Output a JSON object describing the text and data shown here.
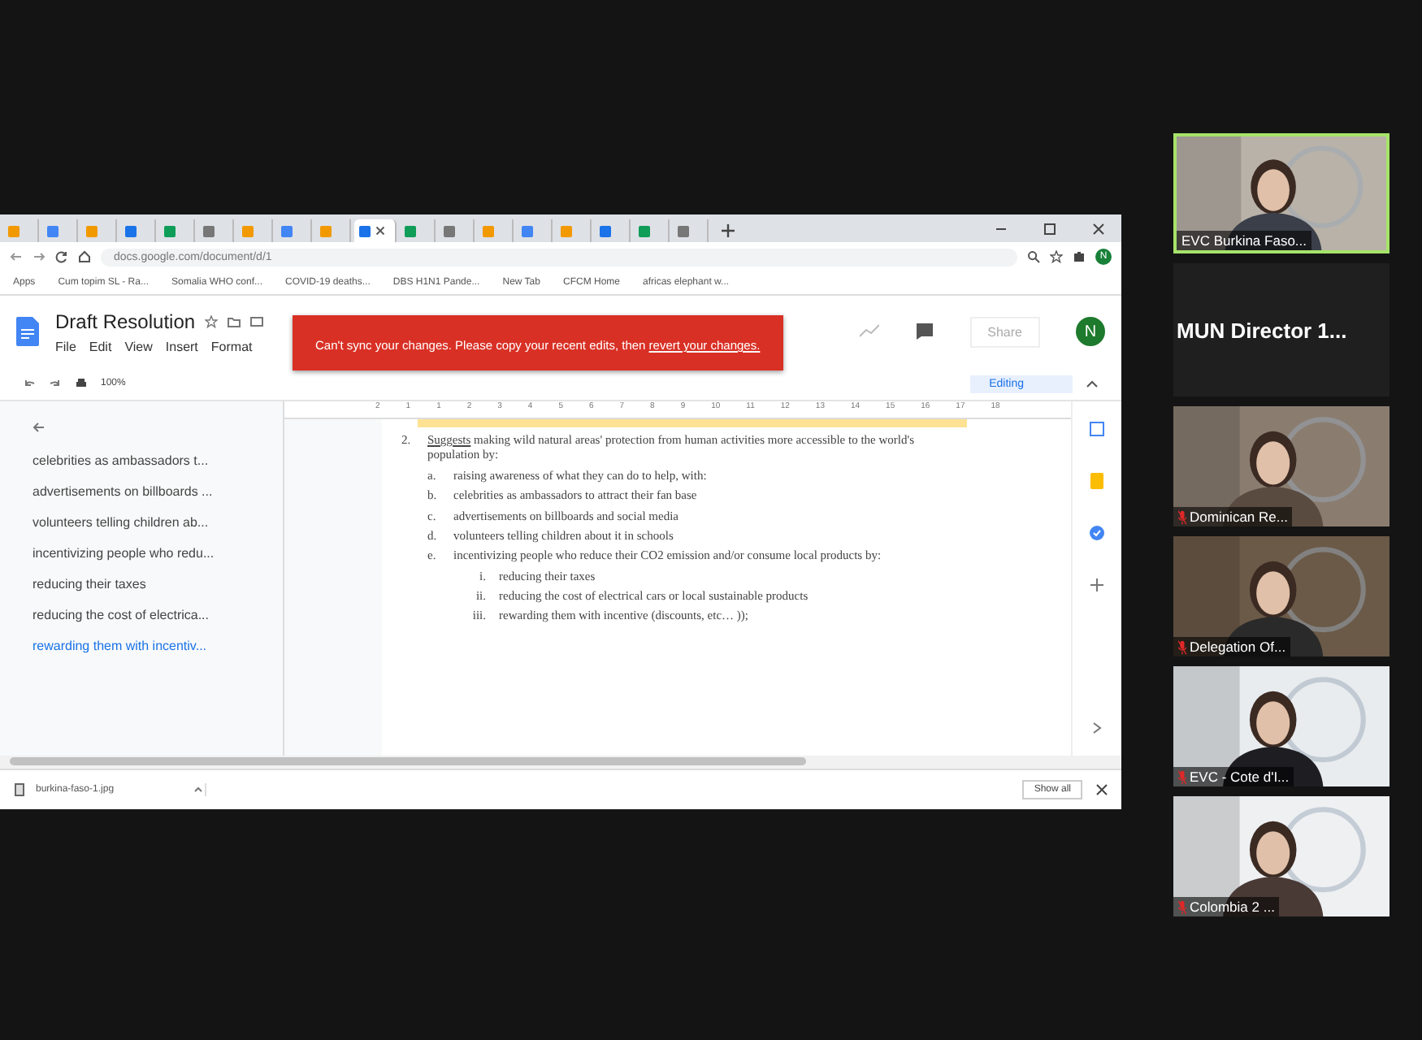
{
  "browser": {
    "tabs": [
      {
        "selected": false
      },
      {
        "selected": false
      },
      {
        "selected": false
      },
      {
        "selected": false
      },
      {
        "selected": false
      },
      {
        "selected": false
      },
      {
        "selected": false
      },
      {
        "selected": false
      },
      {
        "selected": false
      },
      {
        "selected": true
      },
      {
        "selected": false
      },
      {
        "selected": false
      },
      {
        "selected": false
      },
      {
        "selected": false
      },
      {
        "selected": false
      },
      {
        "selected": false
      },
      {
        "selected": false
      },
      {
        "selected": false
      }
    ],
    "url": "docs.google.com/document/d/1",
    "bookmarks": [
      "Apps",
      "Cum topim SL - Ra...",
      "Somalia WHO conf...",
      "COVID-19 deaths...",
      "DBS H1N1 Pande...",
      "New Tab",
      "CFCM Home",
      "africas elephant w..."
    ],
    "profile": "N"
  },
  "doc": {
    "title": "Draft Resolution",
    "menus": [
      "File",
      "Edit",
      "View",
      "Insert",
      "Format"
    ],
    "share": "Share",
    "avatar": "N",
    "zoom": "100%",
    "mode": "Editing",
    "toast": {
      "text": "Can't sync your changes. Please copy your recent edits, then ",
      "link": "revert your changes."
    },
    "ruler": [
      "2",
      "1",
      "1",
      "2",
      "3",
      "4",
      "5",
      "6",
      "7",
      "8",
      "9",
      "10",
      "11",
      "12",
      "13",
      "14",
      "15",
      "16",
      "17",
      "18"
    ],
    "outline": [
      {
        "text": "celebrities as ambassadors t...",
        "selected": false
      },
      {
        "text": "advertisements on billboards ...",
        "selected": false
      },
      {
        "text": "volunteers telling children ab...",
        "selected": false
      },
      {
        "text": "incentivizing people who redu...",
        "selected": false
      },
      {
        "text": "reducing their taxes",
        "selected": false
      },
      {
        "text": "reducing the cost of electrica...",
        "selected": false
      },
      {
        "text": "rewarding them with incentiv...",
        "selected": true
      }
    ],
    "clause": {
      "number": "2.",
      "lead": "Suggests",
      "text": " making wild natural areas' protection from human activities more accessible to the world's population by:"
    },
    "items": [
      {
        "marker": "a.",
        "text": "raising awareness of what they can do to help, with:"
      },
      {
        "marker": "b.",
        "text": "celebrities as ambassadors to attract their fan base"
      },
      {
        "marker": "c.",
        "text": "advertisements on billboards and social media"
      },
      {
        "marker": "d.",
        "text": "volunteers telling children about it in schools"
      },
      {
        "marker": "e.",
        "text": "incentivizing people who reduce their CO2 emission and/or consume local products by:",
        "children": [
          {
            "marker": "i.",
            "text": "reducing their taxes"
          },
          {
            "marker": "ii.",
            "text": "reducing the cost of electrical cars or local sustainable products"
          },
          {
            "marker": "iii.",
            "text": "rewarding them with incentive (discounts, etc… ));"
          }
        ]
      }
    ]
  },
  "downloads": {
    "file": "burkina-faso-1.jpg",
    "show_all": "Show all"
  },
  "participants": [
    {
      "kind": "video",
      "name": "EVC Burkina Faso...",
      "muted": false,
      "active": true
    },
    {
      "kind": "name_only",
      "name": "MUN Director 1...",
      "active": false
    },
    {
      "kind": "video",
      "name": "Dominican Re...",
      "muted": true,
      "active": false
    },
    {
      "kind": "video",
      "name": "Delegation Of...",
      "muted": true,
      "active": false
    },
    {
      "kind": "video",
      "name": "EVC - Cote d'I...",
      "muted": true,
      "active": false
    },
    {
      "kind": "video",
      "name": "Colombia 2 ...",
      "muted": true,
      "active": false
    }
  ]
}
